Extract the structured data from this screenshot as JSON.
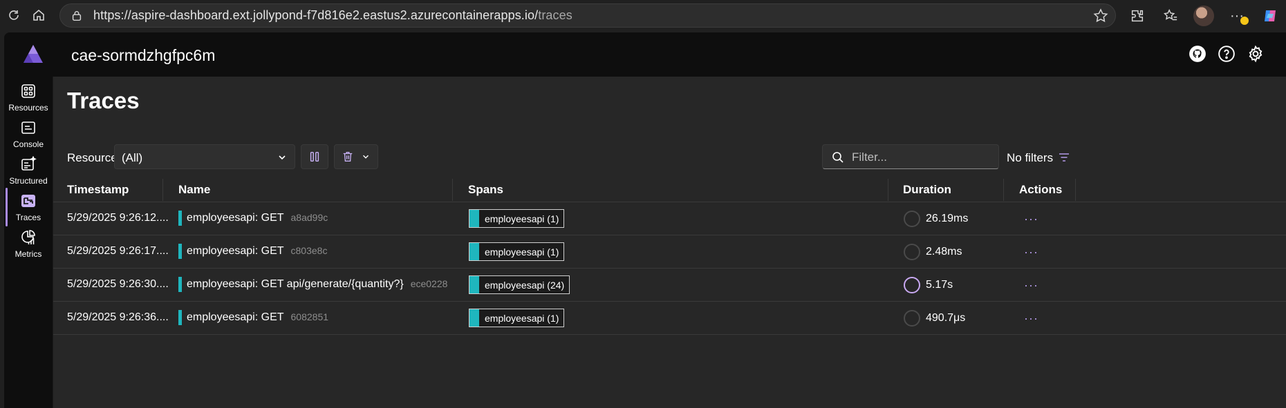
{
  "browser": {
    "url_host": "https://aspire-dashboard.ext.jollypond-f7d816e2.eastus2.azurecontainerapps.io/",
    "url_path": "traces"
  },
  "app": {
    "title": "cae-sormdzhgfpc6m"
  },
  "sidenav": {
    "items": [
      {
        "label": "Resources",
        "icon": "grid-icon"
      },
      {
        "label": "Console",
        "icon": "console-icon"
      },
      {
        "label": "Structured",
        "icon": "structured-icon"
      },
      {
        "label": "Traces",
        "icon": "traces-icon"
      },
      {
        "label": "Metrics",
        "icon": "metrics-icon"
      }
    ],
    "active": "Traces"
  },
  "page": {
    "title": "Traces"
  },
  "toolbar": {
    "resource_label": "Resource",
    "resource_value": "(All)",
    "filter_placeholder": "Filter...",
    "no_filters": "No filters"
  },
  "table": {
    "headers": {
      "timestamp": "Timestamp",
      "name": "Name",
      "spans": "Spans",
      "duration": "Duration",
      "actions": "Actions"
    },
    "rows": [
      {
        "timestamp": "5/29/2025 9:26:12....",
        "name": "employeesapi: GET",
        "trace_id": "a8ad99c",
        "spans": "employeesapi (1)",
        "duration": "26.19ms"
      },
      {
        "timestamp": "5/29/2025 9:26:17....",
        "name": "employeesapi: GET",
        "trace_id": "c803e8c",
        "spans": "employeesapi (1)",
        "duration": "2.48ms"
      },
      {
        "timestamp": "5/29/2025 9:26:30....",
        "name": "employeesapi: GET api/generate/{quantity?}",
        "trace_id": "ece0228",
        "spans": "employeesapi (24)",
        "duration": "5.17s"
      },
      {
        "timestamp": "5/29/2025 9:26:36....",
        "name": "employeesapi: GET",
        "trace_id": "6082851",
        "spans": "employeesapi (1)",
        "duration": "490.7μs"
      }
    ]
  },
  "colors": {
    "accent": "#a98be8",
    "span_fill": "#1fb6be",
    "background": "#272727"
  }
}
